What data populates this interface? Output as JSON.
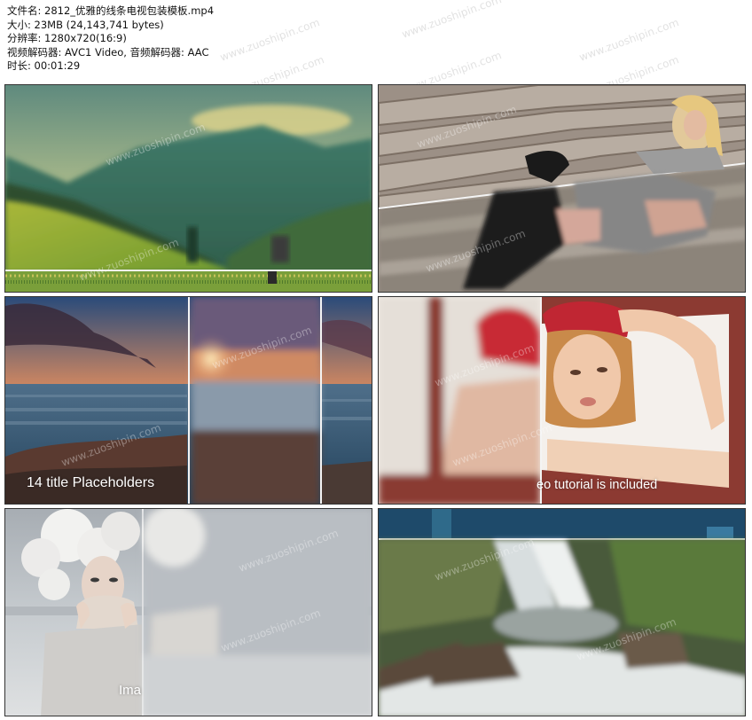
{
  "file_info": {
    "filename": "文件名: 2812_优雅的线条电视包装模板.mp4",
    "size": "大小: 23MB (24,143,741 bytes)",
    "resolution": "分辨率: 1280x720(16:9)",
    "codecs": "视频解码器: AVC1 Video, 音频解码器: AAC",
    "duration": "时长: 00:01:29"
  },
  "watermark": "www.zuoshipin.com",
  "thumbnails": [
    {
      "id": "landscape-mountains",
      "caption": ""
    },
    {
      "id": "woman-on-stairs",
      "caption": ""
    },
    {
      "id": "sunset-sea",
      "caption": "14 title Placeholders"
    },
    {
      "id": "woman-red-hat",
      "caption": "eo tutorial is included"
    },
    {
      "id": "woman-white-curly-hair",
      "caption": "Ima"
    },
    {
      "id": "waterfall",
      "caption": ""
    }
  ]
}
